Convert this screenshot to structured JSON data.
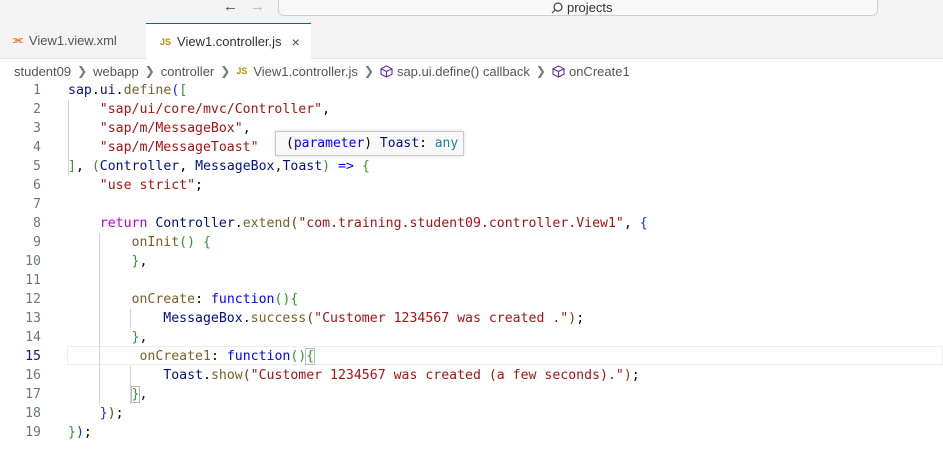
{
  "titlebar": {
    "back_icon": "arrow-left-icon",
    "forward_icon": "arrow-right-icon",
    "search_text": "projects"
  },
  "tabs": [
    {
      "label": "View1.view.xml",
      "icon": "xml-file-icon",
      "active": false
    },
    {
      "label": "View1.controller.js",
      "icon": "js-file-icon",
      "active": true,
      "icon_text": "JS",
      "close": "×"
    }
  ],
  "breadcrumb": {
    "items": [
      "student09",
      "webapp",
      "controller",
      "View1.controller.js",
      "sap.ui.define() callback",
      "onCreate1"
    ],
    "js_icon_text": "JS"
  },
  "hover": {
    "open": "(",
    "kind": "parameter",
    "close": ")",
    "name": " Toast",
    "colon": ": ",
    "type": "any"
  },
  "editor": {
    "active_line": 15,
    "lines": [
      {
        "n": "1",
        "tokens": [
          [
            "id",
            "sap"
          ],
          [
            "plain",
            "."
          ],
          [
            "id",
            "ui"
          ],
          [
            "plain",
            "."
          ],
          [
            "fn",
            "define"
          ],
          [
            "br1",
            "("
          ],
          [
            "br2",
            "["
          ]
        ]
      },
      {
        "n": "2",
        "tokens": [
          [
            "plain",
            "    "
          ],
          [
            "str",
            "\"sap/ui/core/mvc/Controller\""
          ],
          [
            "plain",
            ","
          ]
        ]
      },
      {
        "n": "3",
        "tokens": [
          [
            "plain",
            "    "
          ],
          [
            "str",
            "\"sap/m/MessageBox\""
          ],
          [
            "plain",
            ","
          ]
        ]
      },
      {
        "n": "4",
        "tokens": [
          [
            "plain",
            "    "
          ],
          [
            "str",
            "\"sap/m/MessageToast\""
          ]
        ]
      },
      {
        "n": "5",
        "tokens": [
          [
            "br2",
            "]"
          ],
          [
            "plain",
            ", "
          ],
          [
            "br2",
            "("
          ],
          [
            "id",
            "Controller"
          ],
          [
            "plain",
            ", "
          ],
          [
            "id",
            "MessageBox"
          ],
          [
            "plain",
            ","
          ],
          [
            "id",
            "Toast"
          ],
          [
            "br2",
            ")"
          ],
          [
            "plain",
            " "
          ],
          [
            "kw-blue",
            "=>"
          ],
          [
            "plain",
            " "
          ],
          [
            "br2",
            "{"
          ]
        ]
      },
      {
        "n": "6",
        "tokens": [
          [
            "plain",
            "    "
          ],
          [
            "str",
            "\"use strict\""
          ],
          [
            "plain",
            ";"
          ]
        ]
      },
      {
        "n": "7",
        "tokens": []
      },
      {
        "n": "8",
        "tokens": [
          [
            "plain",
            "    "
          ],
          [
            "kw-purple",
            "return"
          ],
          [
            "plain",
            " "
          ],
          [
            "id",
            "Controller"
          ],
          [
            "plain",
            "."
          ],
          [
            "fn",
            "extend"
          ],
          [
            "br3",
            "("
          ],
          [
            "str",
            "\"com.training.student09.controller.View1\""
          ],
          [
            "plain",
            ", "
          ],
          [
            "br1",
            "{"
          ]
        ]
      },
      {
        "n": "9",
        "tokens": [
          [
            "plain",
            "        "
          ],
          [
            "fn",
            "onInit"
          ],
          [
            "br2",
            "()"
          ],
          [
            "plain",
            " "
          ],
          [
            "br2",
            "{"
          ]
        ]
      },
      {
        "n": "10",
        "tokens": [
          [
            "plain",
            "        "
          ],
          [
            "br2",
            "}"
          ],
          [
            "plain",
            ","
          ]
        ]
      },
      {
        "n": "11",
        "tokens": []
      },
      {
        "n": "12",
        "tokens": [
          [
            "plain",
            "        "
          ],
          [
            "fn",
            "onCreate"
          ],
          [
            "plain",
            ": "
          ],
          [
            "kw-blue",
            "function"
          ],
          [
            "br2",
            "(){"
          ]
        ]
      },
      {
        "n": "13",
        "tokens": [
          [
            "plain",
            "            "
          ],
          [
            "id",
            "MessageBox"
          ],
          [
            "plain",
            "."
          ],
          [
            "fn",
            "success"
          ],
          [
            "br3",
            "("
          ],
          [
            "str",
            "\"Customer 1234567 was created .\""
          ],
          [
            "br3",
            ")"
          ],
          [
            "plain",
            ";"
          ]
        ]
      },
      {
        "n": "14",
        "tokens": [
          [
            "plain",
            "        "
          ],
          [
            "br2",
            "}"
          ],
          [
            "plain",
            ","
          ]
        ]
      },
      {
        "n": "15",
        "tokens": [
          [
            "plain",
            "         "
          ],
          [
            "fn",
            "onCreate1"
          ],
          [
            "plain",
            ": "
          ],
          [
            "kw-blue",
            "function"
          ],
          [
            "br2",
            "()"
          ],
          [
            "br2hl",
            "{"
          ]
        ]
      },
      {
        "n": "16",
        "tokens": [
          [
            "plain",
            "            "
          ],
          [
            "id",
            "Toast"
          ],
          [
            "plain",
            "."
          ],
          [
            "fn",
            "show"
          ],
          [
            "br3",
            "("
          ],
          [
            "str",
            "\"Customer 1234567 was created (a few seconds).\""
          ],
          [
            "br3",
            ")"
          ],
          [
            "plain",
            ";"
          ]
        ]
      },
      {
        "n": "17",
        "tokens": [
          [
            "plain",
            "        "
          ],
          [
            "br2hl",
            "}"
          ],
          [
            "plain",
            ","
          ]
        ]
      },
      {
        "n": "18",
        "tokens": [
          [
            "plain",
            "    "
          ],
          [
            "br1",
            "}"
          ],
          [
            "br3",
            ")"
          ],
          [
            "plain",
            ";"
          ]
        ]
      },
      {
        "n": "19",
        "tokens": [
          [
            "br2",
            "}"
          ],
          [
            "br1",
            ")"
          ],
          [
            "plain",
            ";"
          ]
        ]
      }
    ]
  }
}
